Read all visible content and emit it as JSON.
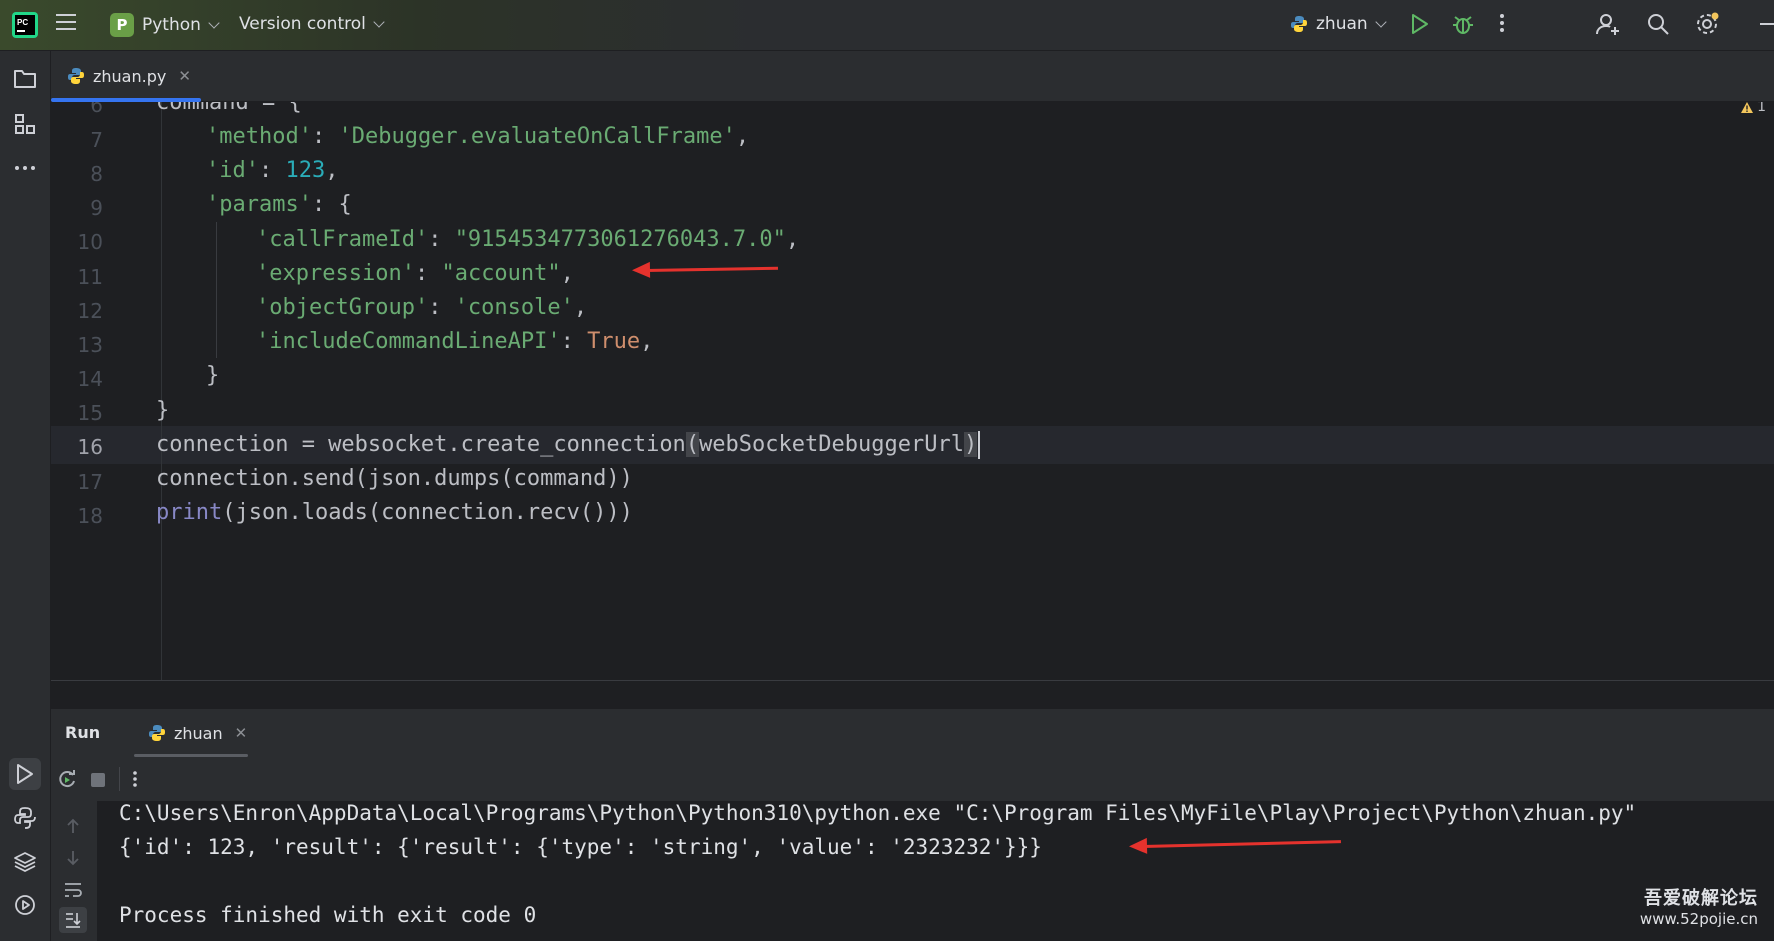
{
  "toolbar": {
    "project_letter": "P",
    "project_name": "Python",
    "vcs_label": "Version control",
    "run_config": "zhuan"
  },
  "tabs": [
    {
      "label": "zhuan.py",
      "close": "✕"
    }
  ],
  "inspection": {
    "warning_count": "1"
  },
  "editor": {
    "line_numbers": [
      "6",
      "7",
      "8",
      "9",
      "10",
      "11",
      "12",
      "13",
      "14",
      "15",
      "16",
      "17",
      "18"
    ],
    "current_line": "16"
  },
  "run_panel": {
    "title": "Run",
    "tab_label": "zhuan",
    "tab_close": "✕",
    "console": [
      "C:\\Users\\Enron\\AppData\\Local\\Programs\\Python\\Python310\\python.exe \"C:\\Program Files\\MyFile\\Play\\Project\\Python\\zhuan.py\"",
      "{'id': 123, 'result': {'result': {'type': 'string', 'value': '2323232'}}}",
      "",
      "Process finished with exit code 0"
    ]
  },
  "watermark": {
    "line1": "吾爱破解论坛",
    "line2": "www.52pojie.cn"
  },
  "colors": {
    "accent": "#3574f0",
    "string": "#6aab73",
    "number": "#2aacb8",
    "keyword": "#cf8e6d",
    "builtin": "#8888c6",
    "annotation_arrow": "#e5322d"
  }
}
